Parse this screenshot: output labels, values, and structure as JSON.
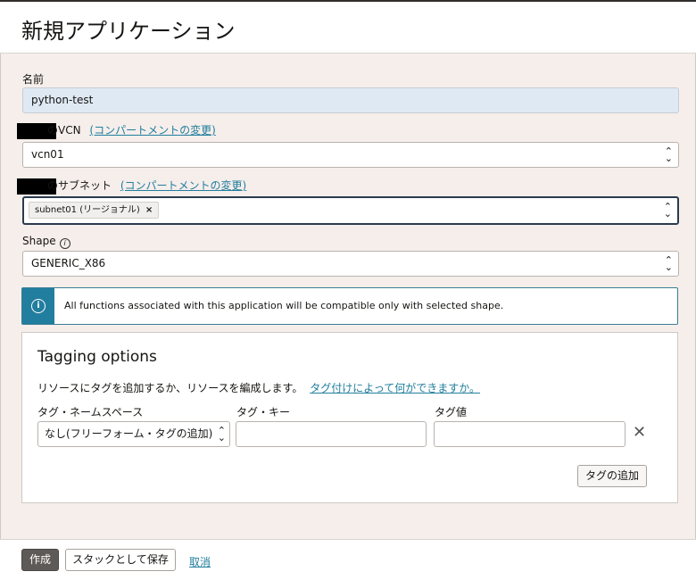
{
  "page": {
    "title": "新規アプリケーション"
  },
  "form": {
    "name": {
      "label": "名前",
      "value": "python-test"
    },
    "vcn": {
      "label_suffix": "のVCN",
      "change_link": "(コンパートメントの変更)",
      "value": "vcn01"
    },
    "subnet": {
      "label_suffix": "のサブネット",
      "change_link": "(コンパートメントの変更)",
      "chip": "subnet01 (リージョナル)",
      "chip_remove": "×"
    },
    "shape": {
      "label": "Shape",
      "value": "GENERIC_X86"
    }
  },
  "notice": {
    "icon": "info-icon",
    "text": "All functions associated with this application will be compatible only with selected shape."
  },
  "tagging": {
    "title": "Tagging options",
    "description": "リソースにタグを追加するか、リソースを編成します。",
    "help_link": "タグ付けによって何ができますか。",
    "namespace_label": "タグ・ネームスペース",
    "namespace_value": "なし(フリーフォーム・タグの追加)",
    "key_label": "タグ・キー",
    "key_value": "",
    "value_label": "タグ値",
    "value_value": "",
    "remove": "✕",
    "add_button": "タグの追加"
  },
  "footer": {
    "create": "作成",
    "save_stack": "スタックとして保存",
    "cancel": "取消"
  },
  "colors": {
    "accent": "#227e9e",
    "primary_button": "#5e5a57",
    "panel_bg": "#f5eeeb"
  }
}
